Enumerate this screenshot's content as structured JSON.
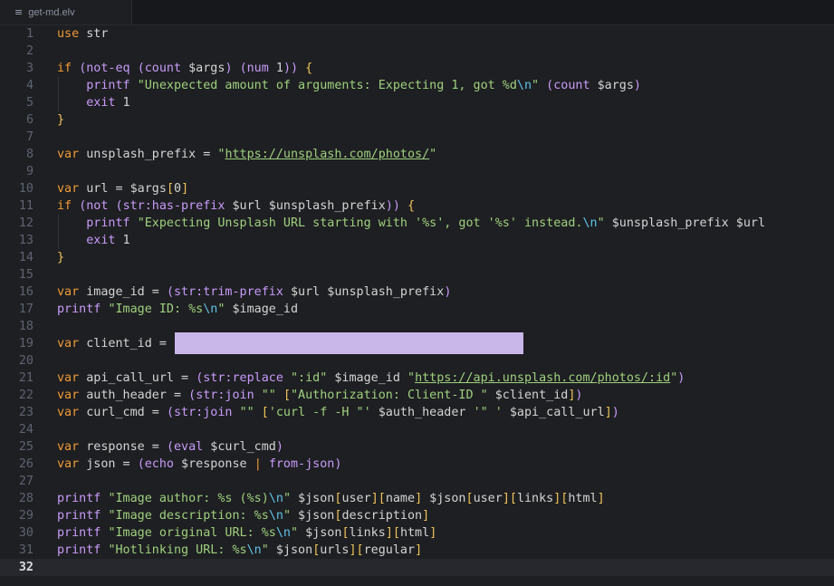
{
  "tab": {
    "icon": "lines-icon",
    "title": "get-md.elv"
  },
  "current_line": 32,
  "lines": [
    {
      "n": 1,
      "tokens": [
        [
          "kw",
          "use"
        ],
        [
          "id",
          " str"
        ]
      ]
    },
    {
      "n": 2,
      "tokens": []
    },
    {
      "n": 3,
      "tokens": [
        [
          "kw",
          "if"
        ],
        [
          "id",
          " "
        ],
        [
          "par",
          "("
        ],
        [
          "fn",
          "not-eq"
        ],
        [
          "id",
          " "
        ],
        [
          "par",
          "("
        ],
        [
          "fn",
          "count"
        ],
        [
          "id",
          " $args"
        ],
        [
          "par",
          ")"
        ],
        [
          "id",
          " "
        ],
        [
          "par",
          "("
        ],
        [
          "fn",
          "num"
        ],
        [
          "id",
          " 1"
        ],
        [
          "par",
          "))"
        ],
        [
          "id",
          " "
        ],
        [
          "brk",
          "{"
        ]
      ]
    },
    {
      "n": 4,
      "tokens": [
        [
          "id",
          "    "
        ],
        [
          "fn",
          "printf"
        ],
        [
          "id",
          " "
        ],
        [
          "str",
          "\"Unexpected amount of arguments: Expecting 1, got %d"
        ],
        [
          "esc",
          "\\n"
        ],
        [
          "str",
          "\""
        ],
        [
          "id",
          " "
        ],
        [
          "par",
          "("
        ],
        [
          "fn",
          "count"
        ],
        [
          "id",
          " $args"
        ],
        [
          "par",
          ")"
        ]
      ]
    },
    {
      "n": 5,
      "tokens": [
        [
          "id",
          "    "
        ],
        [
          "fn",
          "exit"
        ],
        [
          "id",
          " 1"
        ]
      ]
    },
    {
      "n": 6,
      "tokens": [
        [
          "brk",
          "}"
        ]
      ]
    },
    {
      "n": 7,
      "tokens": []
    },
    {
      "n": 8,
      "tokens": [
        [
          "kw",
          "var"
        ],
        [
          "id",
          " unsplash_prefix = "
        ],
        [
          "str",
          "\""
        ],
        [
          "url",
          "https://unsplash.com/photos/"
        ],
        [
          "str",
          "\""
        ]
      ]
    },
    {
      "n": 9,
      "tokens": []
    },
    {
      "n": 10,
      "tokens": [
        [
          "kw",
          "var"
        ],
        [
          "id",
          " url = $args"
        ],
        [
          "brk",
          "["
        ],
        [
          "id",
          "0"
        ],
        [
          "brk",
          "]"
        ]
      ]
    },
    {
      "n": 11,
      "tokens": [
        [
          "kw",
          "if"
        ],
        [
          "id",
          " "
        ],
        [
          "par",
          "("
        ],
        [
          "fn",
          "not"
        ],
        [
          "id",
          " "
        ],
        [
          "par",
          "("
        ],
        [
          "fn",
          "str:has-prefix"
        ],
        [
          "id",
          " $url $unsplash_prefix"
        ],
        [
          "par",
          "))"
        ],
        [
          "id",
          " "
        ],
        [
          "brk",
          "{"
        ]
      ]
    },
    {
      "n": 12,
      "tokens": [
        [
          "id",
          "    "
        ],
        [
          "fn",
          "printf"
        ],
        [
          "id",
          " "
        ],
        [
          "str",
          "\"Expecting Unsplash URL starting with '%s', got '%s' instead."
        ],
        [
          "esc",
          "\\n"
        ],
        [
          "str",
          "\""
        ],
        [
          "id",
          " $unsplash_prefix $url"
        ]
      ]
    },
    {
      "n": 13,
      "tokens": [
        [
          "id",
          "    "
        ],
        [
          "fn",
          "exit"
        ],
        [
          "id",
          " 1"
        ]
      ]
    },
    {
      "n": 14,
      "tokens": [
        [
          "brk",
          "}"
        ]
      ]
    },
    {
      "n": 15,
      "tokens": []
    },
    {
      "n": 16,
      "tokens": [
        [
          "kw",
          "var"
        ],
        [
          "id",
          " image_id = "
        ],
        [
          "par",
          "("
        ],
        [
          "fn",
          "str:trim-prefix"
        ],
        [
          "id",
          " $url $unsplash_prefix"
        ],
        [
          "par",
          ")"
        ]
      ]
    },
    {
      "n": 17,
      "tokens": [
        [
          "fn",
          "printf"
        ],
        [
          "id",
          " "
        ],
        [
          "str",
          "\"Image ID: %s"
        ],
        [
          "esc",
          "\\n"
        ],
        [
          "str",
          "\""
        ],
        [
          "id",
          " $image_id"
        ]
      ]
    },
    {
      "n": 18,
      "tokens": []
    },
    {
      "n": 19,
      "tokens": [
        [
          "kw",
          "var"
        ],
        [
          "id",
          " client_id = "
        ]
      ]
    },
    {
      "n": 20,
      "tokens": []
    },
    {
      "n": 21,
      "tokens": [
        [
          "kw",
          "var"
        ],
        [
          "id",
          " api_call_url = "
        ],
        [
          "par",
          "("
        ],
        [
          "fn",
          "str:replace"
        ],
        [
          "id",
          " "
        ],
        [
          "str",
          "\":id\""
        ],
        [
          "id",
          " $image_id "
        ],
        [
          "str",
          "\""
        ],
        [
          "url",
          "https://api.unsplash.com/photos/:id"
        ],
        [
          "str",
          "\""
        ],
        [
          "par",
          ")"
        ]
      ]
    },
    {
      "n": 22,
      "tokens": [
        [
          "kw",
          "var"
        ],
        [
          "id",
          " auth_header = "
        ],
        [
          "par",
          "("
        ],
        [
          "fn",
          "str:join"
        ],
        [
          "id",
          " "
        ],
        [
          "str",
          "\"\""
        ],
        [
          "id",
          " "
        ],
        [
          "brk",
          "["
        ],
        [
          "str",
          "\"Authorization: Client-ID \""
        ],
        [
          "id",
          " $client_id"
        ],
        [
          "brk",
          "]"
        ],
        [
          "par",
          ")"
        ]
      ]
    },
    {
      "n": 23,
      "tokens": [
        [
          "kw",
          "var"
        ],
        [
          "id",
          " curl_cmd = "
        ],
        [
          "par",
          "("
        ],
        [
          "fn",
          "str:join"
        ],
        [
          "id",
          " "
        ],
        [
          "str",
          "\"\""
        ],
        [
          "id",
          " "
        ],
        [
          "brk",
          "["
        ],
        [
          "str",
          "'curl -f -H \"'"
        ],
        [
          "id",
          " $auth_header "
        ],
        [
          "str",
          "'\" '"
        ],
        [
          "id",
          " $api_call_url"
        ],
        [
          "brk",
          "]"
        ],
        [
          "par",
          ")"
        ]
      ]
    },
    {
      "n": 24,
      "tokens": []
    },
    {
      "n": 25,
      "tokens": [
        [
          "kw",
          "var"
        ],
        [
          "id",
          " response = "
        ],
        [
          "par",
          "("
        ],
        [
          "fn",
          "eval"
        ],
        [
          "id",
          " $curl_cmd"
        ],
        [
          "par",
          ")"
        ]
      ]
    },
    {
      "n": 26,
      "tokens": [
        [
          "kw",
          "var"
        ],
        [
          "id",
          " json = "
        ],
        [
          "par",
          "("
        ],
        [
          "fn",
          "echo"
        ],
        [
          "id",
          " $response "
        ],
        [
          "kw",
          "|"
        ],
        [
          "id",
          " "
        ],
        [
          "fn",
          "from-json"
        ],
        [
          "par",
          ")"
        ]
      ]
    },
    {
      "n": 27,
      "tokens": []
    },
    {
      "n": 28,
      "tokens": [
        [
          "fn",
          "printf"
        ],
        [
          "id",
          " "
        ],
        [
          "str",
          "\"Image author: %s (%s)"
        ],
        [
          "esc",
          "\\n"
        ],
        [
          "str",
          "\""
        ],
        [
          "id",
          " $json"
        ],
        [
          "brk",
          "["
        ],
        [
          "id",
          "user"
        ],
        [
          "brk",
          "]["
        ],
        [
          "id",
          "name"
        ],
        [
          "brk",
          "]"
        ],
        [
          "id",
          " $json"
        ],
        [
          "brk",
          "["
        ],
        [
          "id",
          "user"
        ],
        [
          "brk",
          "]["
        ],
        [
          "id",
          "links"
        ],
        [
          "brk",
          "]["
        ],
        [
          "id",
          "html"
        ],
        [
          "brk",
          "]"
        ]
      ]
    },
    {
      "n": 29,
      "tokens": [
        [
          "fn",
          "printf"
        ],
        [
          "id",
          " "
        ],
        [
          "str",
          "\"Image description: %s"
        ],
        [
          "esc",
          "\\n"
        ],
        [
          "str",
          "\""
        ],
        [
          "id",
          " $json"
        ],
        [
          "brk",
          "["
        ],
        [
          "id",
          "description"
        ],
        [
          "brk",
          "]"
        ]
      ]
    },
    {
      "n": 30,
      "tokens": [
        [
          "fn",
          "printf"
        ],
        [
          "id",
          " "
        ],
        [
          "str",
          "\"Image original URL: %s"
        ],
        [
          "esc",
          "\\n"
        ],
        [
          "str",
          "\""
        ],
        [
          "id",
          " $json"
        ],
        [
          "brk",
          "["
        ],
        [
          "id",
          "links"
        ],
        [
          "brk",
          "]["
        ],
        [
          "id",
          "html"
        ],
        [
          "brk",
          "]"
        ]
      ]
    },
    {
      "n": 31,
      "tokens": [
        [
          "fn",
          "printf"
        ],
        [
          "id",
          " "
        ],
        [
          "str",
          "\"Hotlinking URL: %s"
        ],
        [
          "esc",
          "\\n"
        ],
        [
          "str",
          "\""
        ],
        [
          "id",
          " $json"
        ],
        [
          "brk",
          "["
        ],
        [
          "id",
          "urls"
        ],
        [
          "brk",
          "]["
        ],
        [
          "id",
          "regular"
        ],
        [
          "brk",
          "]"
        ]
      ]
    },
    {
      "n": 32,
      "tokens": []
    }
  ],
  "colors": {
    "background": "#1e1f22",
    "redaction": "#c9b7ea"
  }
}
